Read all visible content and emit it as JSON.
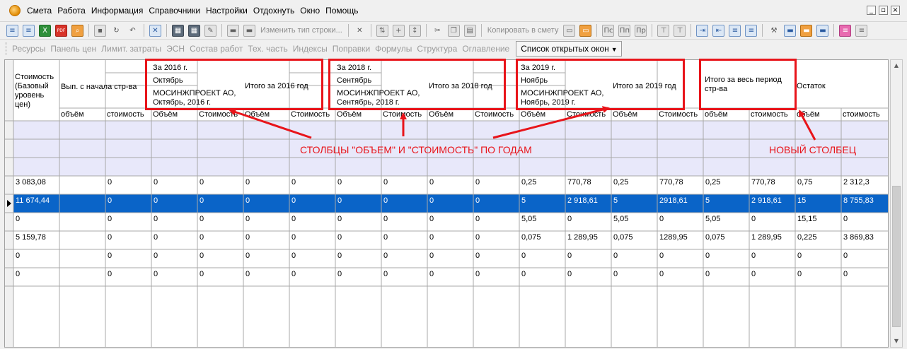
{
  "menu": [
    "Смета",
    "Работа",
    "Информация",
    "Справочники",
    "Настройки",
    "Отдохнуть",
    "Окно",
    "Помощь"
  ],
  "window_controls": [
    "_",
    "▫",
    "×"
  ],
  "toolbar": {
    "change_row_type": "Изменить тип строки...",
    "copy_to_estimate": "Копировать в смету",
    "icons": [
      "insert-row-icon",
      "insert-subrow-icon",
      "excel-icon",
      "pdf-icon",
      "search-icon",
      "save-icon",
      "refresh-icon",
      "undo-icon",
      "delete-icon",
      "resources-icon",
      "cut-icon",
      "copy-icon",
      "paste-icon",
      "columns-icon",
      "vehicle-icon",
      "book-icon"
    ]
  },
  "tabs": [
    "Ресурсы",
    "Панель цен",
    "Лимит. затраты",
    "ЭСН",
    "Состав работ",
    "Тех. часть",
    "Индексы",
    "Поправки",
    "Формулы",
    "Структура",
    "Оглавление"
  ],
  "open_windows": "Список открытых окон",
  "grid": {
    "headers": {
      "cost_base": "Стоимость (Базовый уровень цен)",
      "done_since_start": "Вып. с начала стр-ва",
      "g2016_year": "За 2016 г.",
      "g2016_month": "Октябрь",
      "g2016_org": "МОСИНЖПРОЕКТ АО, Октябрь, 2016 г.",
      "g2016_total": "Итого за 2016 год",
      "g2018_year": "За 2018 г.",
      "g2018_month": "Сентябрь",
      "g2018_org": "МОСИНЖПРОЕКТ АО, Сентябрь, 2018 г.",
      "g2018_total": "Итого за 2018 год",
      "g2019_year": "За 2019 г.",
      "g2019_month": "Ноябрь",
      "g2019_org": "МОСИНЖПРОЕКТ АО, Ноябрь, 2019 г.",
      "g2019_total": "Итого за 2019 год",
      "total_period": "Итого за весь период стр-ва",
      "remainder": "Остаток"
    },
    "subheaders": [
      "объём",
      "стоимость",
      "Объём",
      "Стоимость",
      "Объём",
      "Стоимость",
      "Объём",
      "Стоимость",
      "Объём",
      "Стоимость",
      "Объём",
      "Стоимость",
      "Объём",
      "Стоимость",
      "объём",
      "стоимость",
      "объём",
      "стоимость"
    ],
    "rows": [
      {
        "cells": [
          "",
          "",
          "",
          "",
          "",
          "",
          "",
          "",
          "",
          "",
          "",
          "",
          "",
          "",
          "",
          "",
          "",
          "",
          ""
        ]
      },
      {
        "cells": [
          "",
          "",
          "",
          "",
          "",
          "",
          "",
          "",
          "",
          "",
          "",
          "",
          "",
          "",
          "",
          "",
          "",
          "",
          ""
        ]
      },
      {
        "cells": [
          "",
          "",
          "",
          "",
          "",
          "",
          "",
          "",
          "",
          "",
          "",
          "",
          "",
          "",
          "",
          "",
          "",
          "",
          ""
        ]
      },
      {
        "cells": [
          "3 083,08",
          "",
          "0",
          "0",
          "0",
          "0",
          "0",
          "0",
          "0",
          "0",
          "0",
          "0,25",
          "770,78",
          "0,25",
          "770,78",
          "0,25",
          "770,78",
          "0,75",
          "2 312,3"
        ]
      },
      {
        "cells": [
          "11 674,44",
          "",
          "0",
          "0",
          "0",
          "0",
          "0",
          "0",
          "0",
          "0",
          "0",
          "5",
          "2 918,61",
          "5",
          "2918,61",
          "5",
          "2 918,61",
          "15",
          "8 755,83"
        ]
      },
      {
        "cells": [
          "0",
          "",
          "0",
          "0",
          "0",
          "0",
          "0",
          "0",
          "0",
          "0",
          "0",
          "5,05",
          "0",
          "5,05",
          "0",
          "5,05",
          "0",
          "15,15",
          "0"
        ]
      },
      {
        "cells": [
          "5 159,78",
          "",
          "0",
          "0",
          "0",
          "0",
          "0",
          "0",
          "0",
          "0",
          "0",
          "0,075",
          "1 289,95",
          "0,075",
          "1289,95",
          "0,075",
          "1 289,95",
          "0,225",
          "3 869,83"
        ]
      },
      {
        "cells": [
          "0",
          "",
          "0",
          "0",
          "0",
          "0",
          "0",
          "0",
          "0",
          "0",
          "0",
          "0",
          "0",
          "0",
          "0",
          "0",
          "0",
          "0",
          "0"
        ]
      },
      {
        "cells": [
          "0",
          "",
          "0",
          "0",
          "0",
          "0",
          "0",
          "0",
          "0",
          "0",
          "0",
          "0",
          "0",
          "0",
          "0",
          "0",
          "0",
          "0",
          "0"
        ]
      }
    ],
    "selected_row": 4,
    "shaded_rows": [
      0,
      1,
      2
    ]
  },
  "annotations": {
    "columns_label": "СТОЛБЦЫ \"ОБЪЕМ\" И \"СТОИМОСТЬ\" ПО ГОДАМ",
    "new_column_label": "НОВЫЙ СТОЛБЕЦ",
    "color": "#e8141a"
  },
  "colors": {
    "selection": "#0a64c8",
    "shaded_row": "#e8e8fa",
    "grid_line": "#a8a8a8"
  }
}
